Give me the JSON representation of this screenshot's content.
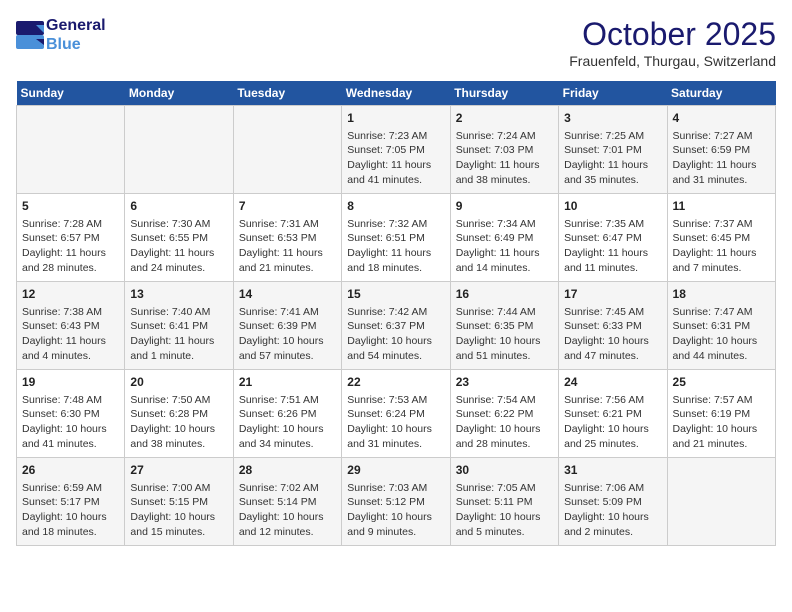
{
  "logo": {
    "line1": "General",
    "line2": "Blue"
  },
  "title": "October 2025",
  "location": "Frauenfeld, Thurgau, Switzerland",
  "weekdays": [
    "Sunday",
    "Monday",
    "Tuesday",
    "Wednesday",
    "Thursday",
    "Friday",
    "Saturday"
  ],
  "weeks": [
    [
      {
        "day": "",
        "info": ""
      },
      {
        "day": "",
        "info": ""
      },
      {
        "day": "",
        "info": ""
      },
      {
        "day": "1",
        "info": "Sunrise: 7:23 AM\nSunset: 7:05 PM\nDaylight: 11 hours\nand 41 minutes."
      },
      {
        "day": "2",
        "info": "Sunrise: 7:24 AM\nSunset: 7:03 PM\nDaylight: 11 hours\nand 38 minutes."
      },
      {
        "day": "3",
        "info": "Sunrise: 7:25 AM\nSunset: 7:01 PM\nDaylight: 11 hours\nand 35 minutes."
      },
      {
        "day": "4",
        "info": "Sunrise: 7:27 AM\nSunset: 6:59 PM\nDaylight: 11 hours\nand 31 minutes."
      }
    ],
    [
      {
        "day": "5",
        "info": "Sunrise: 7:28 AM\nSunset: 6:57 PM\nDaylight: 11 hours\nand 28 minutes."
      },
      {
        "day": "6",
        "info": "Sunrise: 7:30 AM\nSunset: 6:55 PM\nDaylight: 11 hours\nand 24 minutes."
      },
      {
        "day": "7",
        "info": "Sunrise: 7:31 AM\nSunset: 6:53 PM\nDaylight: 11 hours\nand 21 minutes."
      },
      {
        "day": "8",
        "info": "Sunrise: 7:32 AM\nSunset: 6:51 PM\nDaylight: 11 hours\nand 18 minutes."
      },
      {
        "day": "9",
        "info": "Sunrise: 7:34 AM\nSunset: 6:49 PM\nDaylight: 11 hours\nand 14 minutes."
      },
      {
        "day": "10",
        "info": "Sunrise: 7:35 AM\nSunset: 6:47 PM\nDaylight: 11 hours\nand 11 minutes."
      },
      {
        "day": "11",
        "info": "Sunrise: 7:37 AM\nSunset: 6:45 PM\nDaylight: 11 hours\nand 7 minutes."
      }
    ],
    [
      {
        "day": "12",
        "info": "Sunrise: 7:38 AM\nSunset: 6:43 PM\nDaylight: 11 hours\nand 4 minutes."
      },
      {
        "day": "13",
        "info": "Sunrise: 7:40 AM\nSunset: 6:41 PM\nDaylight: 11 hours\nand 1 minute."
      },
      {
        "day": "14",
        "info": "Sunrise: 7:41 AM\nSunset: 6:39 PM\nDaylight: 10 hours\nand 57 minutes."
      },
      {
        "day": "15",
        "info": "Sunrise: 7:42 AM\nSunset: 6:37 PM\nDaylight: 10 hours\nand 54 minutes."
      },
      {
        "day": "16",
        "info": "Sunrise: 7:44 AM\nSunset: 6:35 PM\nDaylight: 10 hours\nand 51 minutes."
      },
      {
        "day": "17",
        "info": "Sunrise: 7:45 AM\nSunset: 6:33 PM\nDaylight: 10 hours\nand 47 minutes."
      },
      {
        "day": "18",
        "info": "Sunrise: 7:47 AM\nSunset: 6:31 PM\nDaylight: 10 hours\nand 44 minutes."
      }
    ],
    [
      {
        "day": "19",
        "info": "Sunrise: 7:48 AM\nSunset: 6:30 PM\nDaylight: 10 hours\nand 41 minutes."
      },
      {
        "day": "20",
        "info": "Sunrise: 7:50 AM\nSunset: 6:28 PM\nDaylight: 10 hours\nand 38 minutes."
      },
      {
        "day": "21",
        "info": "Sunrise: 7:51 AM\nSunset: 6:26 PM\nDaylight: 10 hours\nand 34 minutes."
      },
      {
        "day": "22",
        "info": "Sunrise: 7:53 AM\nSunset: 6:24 PM\nDaylight: 10 hours\nand 31 minutes."
      },
      {
        "day": "23",
        "info": "Sunrise: 7:54 AM\nSunset: 6:22 PM\nDaylight: 10 hours\nand 28 minutes."
      },
      {
        "day": "24",
        "info": "Sunrise: 7:56 AM\nSunset: 6:21 PM\nDaylight: 10 hours\nand 25 minutes."
      },
      {
        "day": "25",
        "info": "Sunrise: 7:57 AM\nSunset: 6:19 PM\nDaylight: 10 hours\nand 21 minutes."
      }
    ],
    [
      {
        "day": "26",
        "info": "Sunrise: 6:59 AM\nSunset: 5:17 PM\nDaylight: 10 hours\nand 18 minutes."
      },
      {
        "day": "27",
        "info": "Sunrise: 7:00 AM\nSunset: 5:15 PM\nDaylight: 10 hours\nand 15 minutes."
      },
      {
        "day": "28",
        "info": "Sunrise: 7:02 AM\nSunset: 5:14 PM\nDaylight: 10 hours\nand 12 minutes."
      },
      {
        "day": "29",
        "info": "Sunrise: 7:03 AM\nSunset: 5:12 PM\nDaylight: 10 hours\nand 9 minutes."
      },
      {
        "day": "30",
        "info": "Sunrise: 7:05 AM\nSunset: 5:11 PM\nDaylight: 10 hours\nand 5 minutes."
      },
      {
        "day": "31",
        "info": "Sunrise: 7:06 AM\nSunset: 5:09 PM\nDaylight: 10 hours\nand 2 minutes."
      },
      {
        "day": "",
        "info": ""
      }
    ]
  ]
}
